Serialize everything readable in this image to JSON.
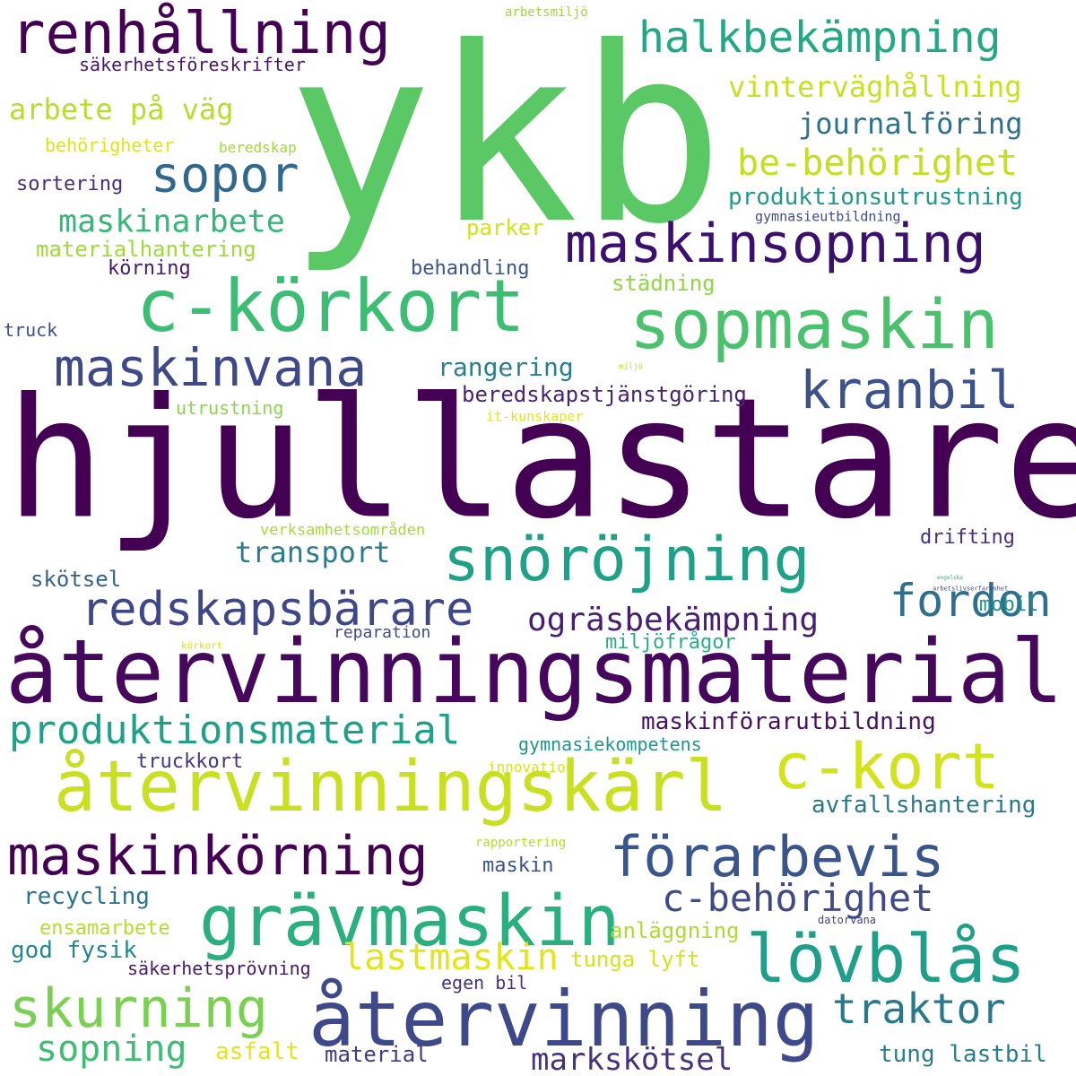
{
  "words": [
    {
      "text": "ykb",
      "color": "#5ac864"
    },
    {
      "text": "hjullastare",
      "color": "#440154"
    },
    {
      "text": "återvinningsmaterial",
      "color": "#46085c"
    },
    {
      "text": "renhållning",
      "color": "#440154"
    },
    {
      "text": "halkbekämpning",
      "color": "#22a884"
    },
    {
      "text": "vinterväghållning",
      "color": "#c8e020"
    },
    {
      "text": "säkerhetsföreskrifter",
      "color": "#481769"
    },
    {
      "text": "arbetsmiljö",
      "color": "#9bd93c"
    },
    {
      "text": "arbete på väg",
      "color": "#b5de2b"
    },
    {
      "text": "journalföring",
      "color": "#2c728e"
    },
    {
      "text": "behörigheter",
      "color": "#dde318"
    },
    {
      "text": "beredskap",
      "color": "#a0da39"
    },
    {
      "text": "be-behörighet",
      "color": "#c2df23"
    },
    {
      "text": "sopor",
      "color": "#31688e"
    },
    {
      "text": "sortering",
      "color": "#472d7b"
    },
    {
      "text": "produktionsutrustning",
      "color": "#1f9a8a"
    },
    {
      "text": "gymnasieutbildning",
      "color": "#3e4a89"
    },
    {
      "text": "maskinarbete",
      "color": "#35b779"
    },
    {
      "text": "materialhantering",
      "color": "#9fda3a"
    },
    {
      "text": "parker",
      "color": "#d2e21b"
    },
    {
      "text": "maskinsopning",
      "color": "#3b0f70"
    },
    {
      "text": "körning",
      "color": "#481a6c"
    },
    {
      "text": "behandling",
      "color": "#39568c"
    },
    {
      "text": "städning",
      "color": "#8fd744"
    },
    {
      "text": "c-körkort",
      "color": "#3dbc74"
    },
    {
      "text": "sopmaskin",
      "color": "#4ac16d"
    },
    {
      "text": "truck",
      "color": "#3b528b"
    },
    {
      "text": "maskinvana",
      "color": "#3e4989"
    },
    {
      "text": "rangering",
      "color": "#277f8e"
    },
    {
      "text": "miljö",
      "color": "#b8de29"
    },
    {
      "text": "kranbil",
      "color": "#3b528b"
    },
    {
      "text": "beredskapstjänstgöring",
      "color": "#482475"
    },
    {
      "text": "utrustning",
      "color": "#8bd646"
    },
    {
      "text": "it-kunskaper",
      "color": "#e5e419"
    },
    {
      "text": "verksamhetsområden",
      "color": "#a5db36"
    },
    {
      "text": "transport",
      "color": "#287d8e"
    },
    {
      "text": "drifting",
      "color": "#472f7d"
    },
    {
      "text": "snöröjning",
      "color": "#1fa187"
    },
    {
      "text": "skötsel",
      "color": "#33638d"
    },
    {
      "text": "redskapsbärare",
      "color": "#3f4788"
    },
    {
      "text": "fordon",
      "color": "#2e6e8e"
    },
    {
      "text": "ogräsbekämpning",
      "color": "#481f70"
    },
    {
      "text": "arbetslivserfarenhet",
      "color": "#3e4a89"
    },
    {
      "text": "mobil",
      "color": "#21908d"
    },
    {
      "text": "engelska",
      "color": "#2db27d"
    },
    {
      "text": "kö­rkort",
      "color": "#d5e21a"
    },
    {
      "text": "reparation",
      "color": "#3e4c8a"
    },
    {
      "text": "miljöfrågor",
      "color": "#2ab07f"
    },
    {
      "text": "produktionsmaterial",
      "color": "#1fa088"
    },
    {
      "text": "maskinförarutbildning",
      "color": "#471063"
    },
    {
      "text": "gymnasiekompetens",
      "color": "#1f968b"
    },
    {
      "text": "truckkort",
      "color": "#463480"
    },
    {
      "text": "innovation",
      "color": "#dae319"
    },
    {
      "text": "återvinningskärl",
      "color": "#c8e020"
    },
    {
      "text": "c-kort",
      "color": "#d2e21b"
    },
    {
      "text": "avfallshantering",
      "color": "#29798e"
    },
    {
      "text": "rapportering",
      "color": "#b2dd2d"
    },
    {
      "text": "maskinkörning",
      "color": "#440154"
    },
    {
      "text": "förarbevis",
      "color": "#39568c"
    },
    {
      "text": "maskin",
      "color": "#3b528b"
    },
    {
      "text": "c-behörighet",
      "color": "#3e4a89"
    },
    {
      "text": "recycling",
      "color": "#2c728e"
    },
    {
      "text": "grävmaskin",
      "color": "#2ab07f"
    },
    {
      "text": "datorvana",
      "color": "#404688"
    },
    {
      "text": "ensamarbete",
      "color": "#b5de2b"
    },
    {
      "text": "anläggning",
      "color": "#addc30"
    },
    {
      "text": "god fysik",
      "color": "#23888e"
    },
    {
      "text": "lastmaskin",
      "color": "#e5e419"
    },
    {
      "text": "lövblås",
      "color": "#1f9e89"
    },
    {
      "text": "tunga lyft",
      "color": "#d8e219"
    },
    {
      "text": "säkerhetsprövning",
      "color": "#48186a"
    },
    {
      "text": "egen bil",
      "color": "#46337e"
    },
    {
      "text": "skurning",
      "color": "#7ad151"
    },
    {
      "text": "återvinning",
      "color": "#3e4989"
    },
    {
      "text": "traktor",
      "color": "#2a788e"
    },
    {
      "text": "sopning",
      "color": "#3dbc74"
    },
    {
      "text": "asfalt",
      "color": "#e5e419"
    },
    {
      "text": "material",
      "color": "#443983"
    },
    {
      "text": "markskötsel",
      "color": "#46337e"
    },
    {
      "text": "tung lastbil",
      "color": "#277f8e"
    }
  ]
}
